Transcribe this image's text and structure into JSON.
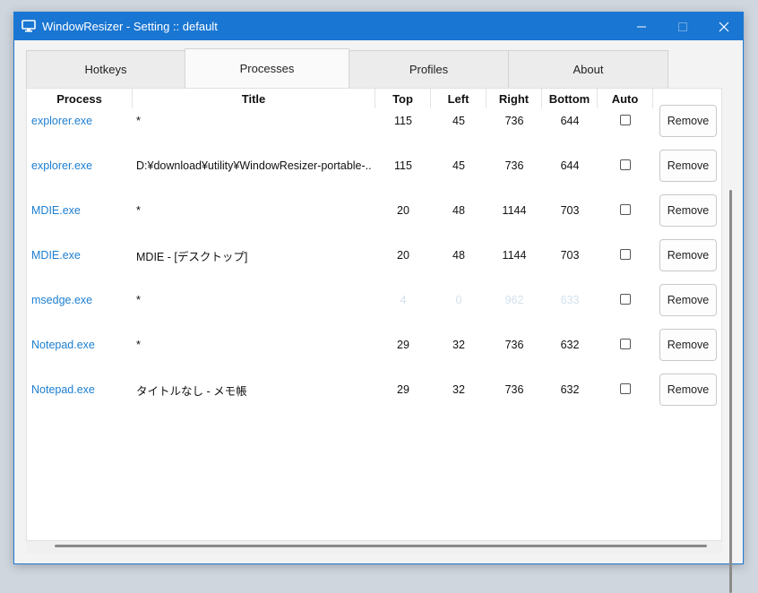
{
  "window": {
    "title": "WindowResizer - Setting :: default",
    "accent": "#1976d2"
  },
  "tabs": [
    {
      "label": "Hotkeys",
      "active": false
    },
    {
      "label": "Processes",
      "active": true
    },
    {
      "label": "Profiles",
      "active": false
    },
    {
      "label": "About",
      "active": false
    }
  ],
  "table": {
    "headers": [
      "Process",
      "Title",
      "Top",
      "Left",
      "Right",
      "Bottom",
      "Auto"
    ],
    "remove_label": "Remove",
    "rows": [
      {
        "process": "explorer.exe",
        "title": "*",
        "top": "115",
        "left": "45",
        "right": "736",
        "bottom": "644",
        "auto": false,
        "dim": false
      },
      {
        "process": "explorer.exe",
        "title": "D:¥download¥utility¥WindowResizer-portable-...",
        "top": "115",
        "left": "45",
        "right": "736",
        "bottom": "644",
        "auto": false,
        "dim": false
      },
      {
        "process": "MDIE.exe",
        "title": "*",
        "top": "20",
        "left": "48",
        "right": "1144",
        "bottom": "703",
        "auto": false,
        "dim": false
      },
      {
        "process": "MDIE.exe",
        "title": "MDIE - [デスクトップ]",
        "top": "20",
        "left": "48",
        "right": "1144",
        "bottom": "703",
        "auto": false,
        "dim": false
      },
      {
        "process": "msedge.exe",
        "title": "*",
        "top": "4",
        "left": "0",
        "right": "962",
        "bottom": "633",
        "auto": false,
        "dim": true
      },
      {
        "process": "Notepad.exe",
        "title": "*",
        "top": "29",
        "left": "32",
        "right": "736",
        "bottom": "632",
        "auto": false,
        "dim": false
      },
      {
        "process": "Notepad.exe",
        "title": "タイトルなし - メモ帳",
        "top": "29",
        "left": "32",
        "right": "736",
        "bottom": "632",
        "auto": false,
        "dim": false
      }
    ]
  }
}
